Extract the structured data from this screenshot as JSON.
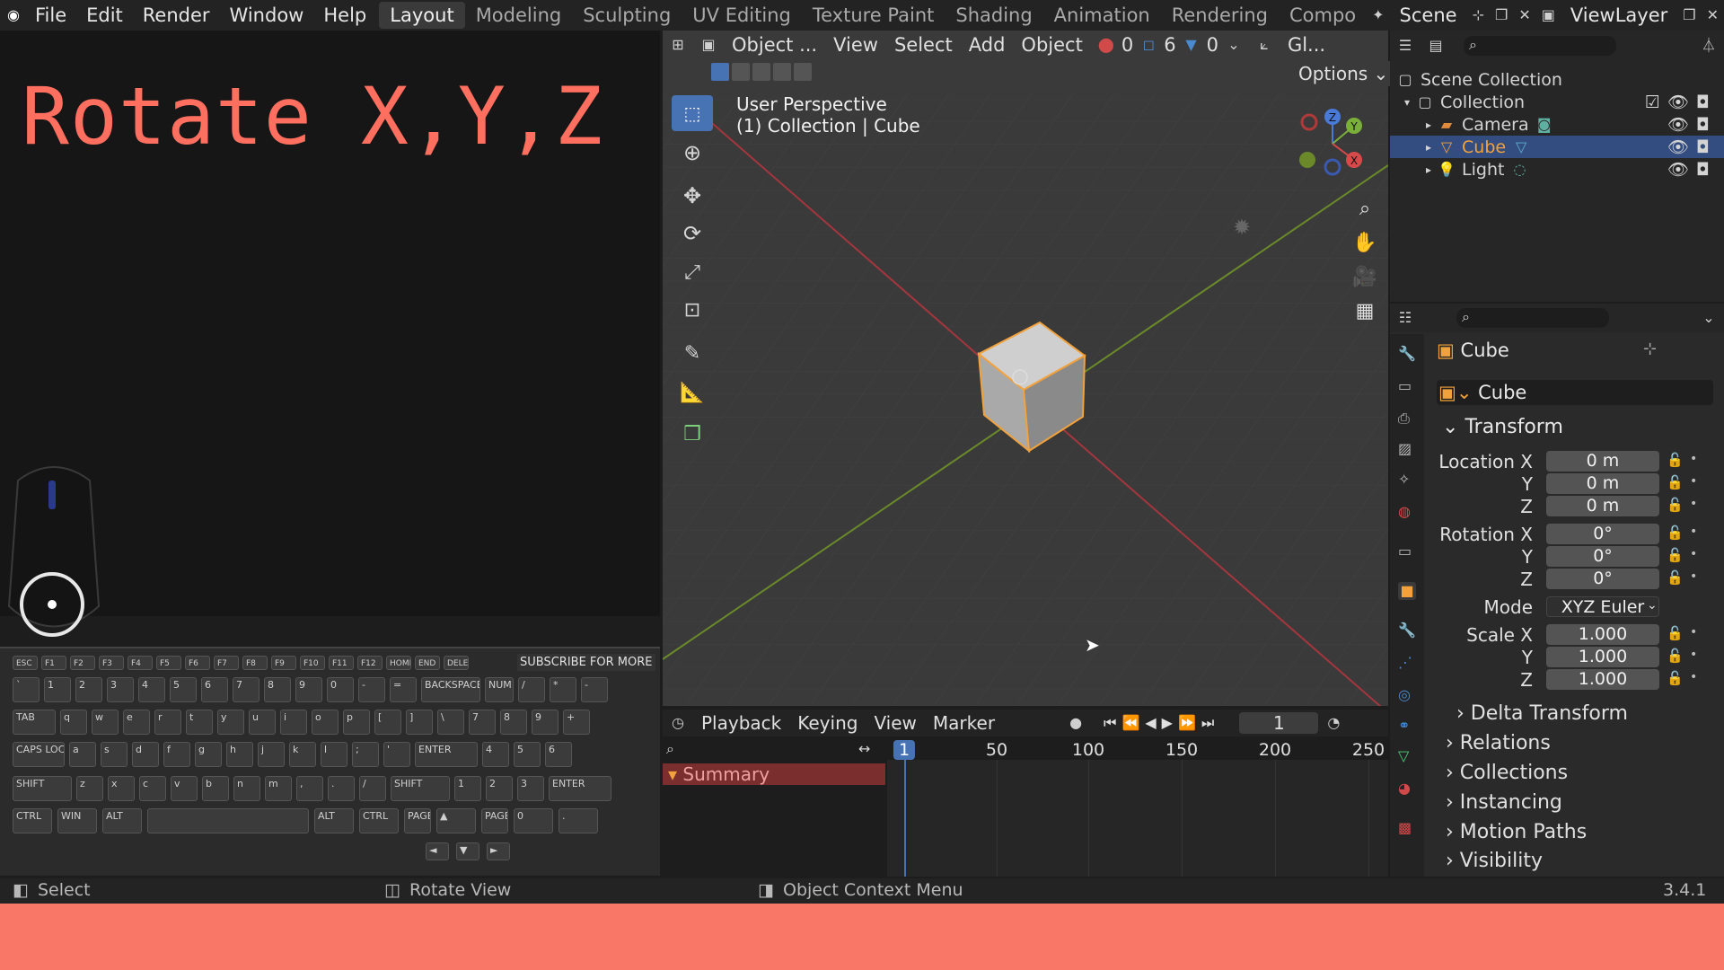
{
  "topbar": {
    "menus": [
      "File",
      "Edit",
      "Render",
      "Window",
      "Help"
    ],
    "workspaces": [
      "Layout",
      "Modeling",
      "Sculpting",
      "UV Editing",
      "Texture Paint",
      "Shading",
      "Animation",
      "Rendering",
      "Compo"
    ],
    "active_workspace": "Layout",
    "scene": "Scene",
    "viewlayer": "ViewLayer"
  },
  "overlay": {
    "title": "Rotate X,Y,Z",
    "subscribe": "SUBSCRIBE FOR MORE"
  },
  "keyboard": {
    "row0": [
      "ESC",
      "F1",
      "F2",
      "F3",
      "F4",
      "F5",
      "F6",
      "F7",
      "F8",
      "F9",
      "F10",
      "F11",
      "F12",
      "HOME",
      "END",
      "DELETE"
    ],
    "row1": [
      "`",
      "1",
      "2",
      "3",
      "4",
      "5",
      "6",
      "7",
      "8",
      "9",
      "0",
      "-",
      "=",
      "BACKSPACE",
      "NUM LOCK",
      "/",
      "*",
      "-"
    ],
    "row2": [
      "TAB",
      "q",
      "w",
      "e",
      "r",
      "t",
      "y",
      "u",
      "i",
      "o",
      "p",
      "[",
      "]",
      "\\",
      "7",
      "8",
      "9",
      "+"
    ],
    "row3": [
      "CAPS LOCK",
      "a",
      "s",
      "d",
      "f",
      "g",
      "h",
      "j",
      "k",
      "l",
      ";",
      "'",
      "ENTER",
      "4",
      "5",
      "6"
    ],
    "row4": [
      "SHIFT",
      "z",
      "x",
      "c",
      "v",
      "b",
      "n",
      "m",
      ",",
      ".",
      "/",
      "SHIFT",
      "1",
      "2",
      "3",
      "ENTER"
    ],
    "row5": [
      "CTRL",
      "WIN",
      "ALT",
      "",
      "ALT",
      "CTRL",
      "PAGE UP",
      "▲",
      "PAGE DN",
      "0",
      "."
    ],
    "row6": [
      "◄",
      "▼",
      "►"
    ]
  },
  "viewport": {
    "mode": "Object ...",
    "menus": [
      "View",
      "Select",
      "Add",
      "Object"
    ],
    "stats": [
      "0",
      "6",
      "0"
    ],
    "transform": "Gl...",
    "options": "Options",
    "info_line1": "User Perspective",
    "info_line2": "(1) Collection | Cube",
    "gizmo": {
      "z": "Z",
      "y": "Y",
      "x": "X"
    }
  },
  "outliner": {
    "scene_collection": "Scene Collection",
    "collection": "Collection",
    "items": [
      "Camera",
      "Cube",
      "Light"
    ]
  },
  "properties": {
    "object_name": "Cube",
    "data_name": "Cube",
    "transform": "Transform",
    "location_label": "Location X",
    "rotation_label": "Rotation X",
    "scale_label": "Scale X",
    "axis_y": "Y",
    "axis_z": "Z",
    "location": [
      "0 m",
      "0 m",
      "0 m"
    ],
    "rotation": [
      "0°",
      "0°",
      "0°"
    ],
    "mode_label": "Mode",
    "mode": "XYZ Euler",
    "scale": [
      "1.000",
      "1.000",
      "1.000"
    ],
    "sections": [
      "Delta Transform",
      "Relations",
      "Collections",
      "Instancing",
      "Motion Paths",
      "Visibility"
    ]
  },
  "timeline": {
    "menus": [
      "Playback",
      "Keying",
      "View",
      "Marker"
    ],
    "current_frame": "1",
    "ticks": [
      "1",
      "50",
      "100",
      "150",
      "200",
      "250"
    ],
    "summary": "Summary"
  },
  "statusbar": {
    "select": "Select",
    "rotate": "Rotate View",
    "context": "Object Context Menu",
    "version": "3.4.1"
  },
  "colors": {
    "accent": "#4772b3",
    "overlay_text": "#ff6f5f",
    "bottom_band": "#f97766",
    "selected_row": "#334d80"
  }
}
